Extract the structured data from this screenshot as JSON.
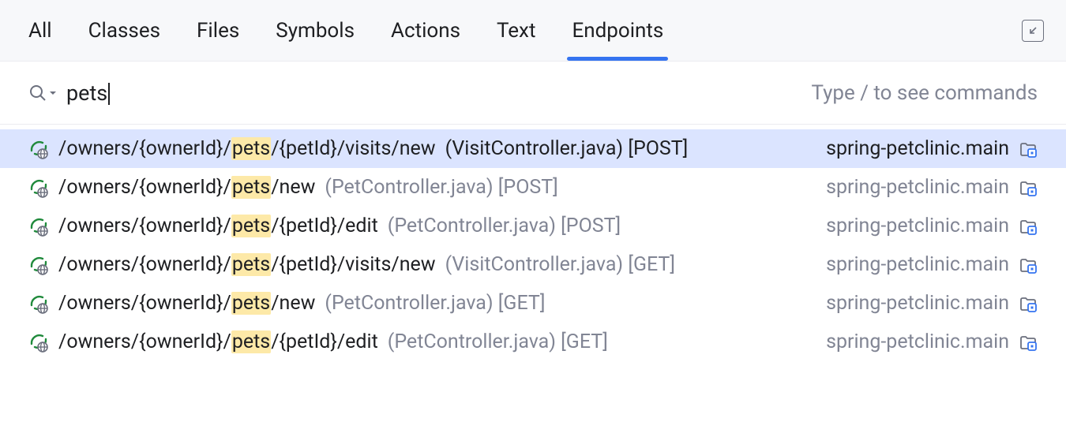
{
  "tabs": [
    {
      "label": "All",
      "active": false
    },
    {
      "label": "Classes",
      "active": false
    },
    {
      "label": "Files",
      "active": false
    },
    {
      "label": "Symbols",
      "active": false
    },
    {
      "label": "Actions",
      "active": false
    },
    {
      "label": "Text",
      "active": false
    },
    {
      "label": "Endpoints",
      "active": true
    }
  ],
  "search": {
    "value": "pets",
    "hint": "Type / to see commands"
  },
  "results": [
    {
      "selected": true,
      "pre": "/owners/{ownerId}/",
      "match": "pets",
      "post": "/{petId}/visits/new",
      "loc": "(VisitController.java) [POST]",
      "module": "spring-petclinic.main"
    },
    {
      "selected": false,
      "pre": "/owners/{ownerId}/",
      "match": "pets",
      "post": "/new",
      "loc": "(PetController.java) [POST]",
      "module": "spring-petclinic.main"
    },
    {
      "selected": false,
      "pre": "/owners/{ownerId}/",
      "match": "pets",
      "post": "/{petId}/edit",
      "loc": "(PetController.java) [POST]",
      "module": "spring-petclinic.main"
    },
    {
      "selected": false,
      "pre": "/owners/{ownerId}/",
      "match": "pets",
      "post": "/{petId}/visits/new",
      "loc": "(VisitController.java) [GET]",
      "module": "spring-petclinic.main"
    },
    {
      "selected": false,
      "pre": "/owners/{ownerId}/",
      "match": "pets",
      "post": "/new",
      "loc": "(PetController.java) [GET]",
      "module": "spring-petclinic.main"
    },
    {
      "selected": false,
      "pre": "/owners/{ownerId}/",
      "match": "pets",
      "post": "/{petId}/edit",
      "loc": "(PetController.java) [GET]",
      "module": "spring-petclinic.main"
    }
  ]
}
